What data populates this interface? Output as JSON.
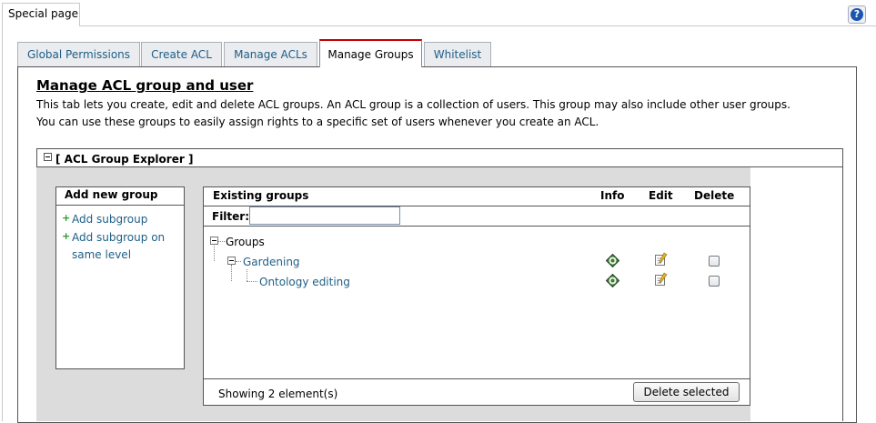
{
  "top_tab": {
    "label": "Special page"
  },
  "help": {
    "glyph": "?"
  },
  "tabs": [
    {
      "label": "Global Permissions"
    },
    {
      "label": "Create ACL"
    },
    {
      "label": "Manage ACLs"
    },
    {
      "label": "Manage Groups",
      "active": true
    },
    {
      "label": "Whitelist"
    }
  ],
  "page": {
    "title": "Manage ACL group and user",
    "description_line1": "This tab lets you create, edit and delete ACL groups. An ACL group is a collection of users. This group may also include other user groups.",
    "description_line2": "You can use these groups to easily assign rights to a specific set of users whenever you create an ACL."
  },
  "explorer": {
    "title": "[ ACL Group Explorer ]",
    "add_panel": {
      "heading": "Add new group",
      "add_subgroup": "Add subgroup",
      "add_same_level_line1": "Add subgroup on",
      "add_same_level_line2": "same level"
    },
    "existing": {
      "heading": "Existing groups",
      "col_info": "Info",
      "col_edit": "Edit",
      "col_delete": "Delete",
      "filter_label": "Filter:",
      "filter_value": "",
      "root": "Groups",
      "groups": [
        {
          "label": "Gardening",
          "checked": false
        },
        {
          "label": "Ontology editing",
          "checked": false
        }
      ],
      "status": "Showing 2 element(s)",
      "delete_button": "Delete selected"
    }
  },
  "colors": {
    "link": "#1f5e87",
    "active_tab_border": "#c40000",
    "plus": "#2b9a2b"
  }
}
